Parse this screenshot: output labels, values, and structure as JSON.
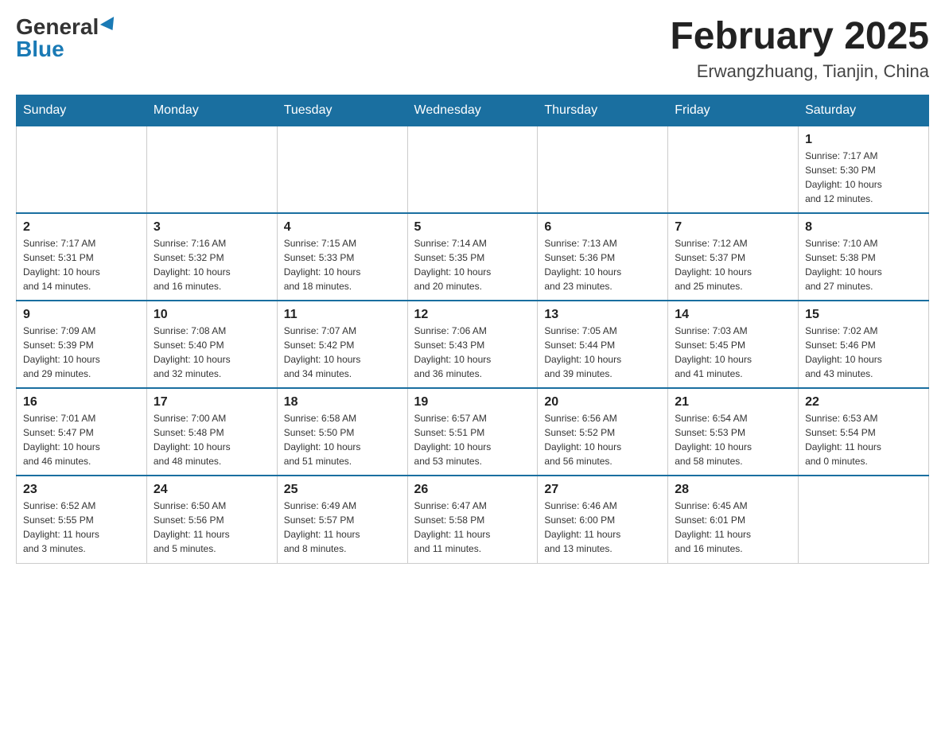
{
  "header": {
    "logo_general": "General",
    "logo_blue": "Blue",
    "month_title": "February 2025",
    "location": "Erwangzhuang, Tianjin, China"
  },
  "weekdays": [
    "Sunday",
    "Monday",
    "Tuesday",
    "Wednesday",
    "Thursday",
    "Friday",
    "Saturday"
  ],
  "weeks": [
    [
      {
        "day": "",
        "info": ""
      },
      {
        "day": "",
        "info": ""
      },
      {
        "day": "",
        "info": ""
      },
      {
        "day": "",
        "info": ""
      },
      {
        "day": "",
        "info": ""
      },
      {
        "day": "",
        "info": ""
      },
      {
        "day": "1",
        "info": "Sunrise: 7:17 AM\nSunset: 5:30 PM\nDaylight: 10 hours\nand 12 minutes."
      }
    ],
    [
      {
        "day": "2",
        "info": "Sunrise: 7:17 AM\nSunset: 5:31 PM\nDaylight: 10 hours\nand 14 minutes."
      },
      {
        "day": "3",
        "info": "Sunrise: 7:16 AM\nSunset: 5:32 PM\nDaylight: 10 hours\nand 16 minutes."
      },
      {
        "day": "4",
        "info": "Sunrise: 7:15 AM\nSunset: 5:33 PM\nDaylight: 10 hours\nand 18 minutes."
      },
      {
        "day": "5",
        "info": "Sunrise: 7:14 AM\nSunset: 5:35 PM\nDaylight: 10 hours\nand 20 minutes."
      },
      {
        "day": "6",
        "info": "Sunrise: 7:13 AM\nSunset: 5:36 PM\nDaylight: 10 hours\nand 23 minutes."
      },
      {
        "day": "7",
        "info": "Sunrise: 7:12 AM\nSunset: 5:37 PM\nDaylight: 10 hours\nand 25 minutes."
      },
      {
        "day": "8",
        "info": "Sunrise: 7:10 AM\nSunset: 5:38 PM\nDaylight: 10 hours\nand 27 minutes."
      }
    ],
    [
      {
        "day": "9",
        "info": "Sunrise: 7:09 AM\nSunset: 5:39 PM\nDaylight: 10 hours\nand 29 minutes."
      },
      {
        "day": "10",
        "info": "Sunrise: 7:08 AM\nSunset: 5:40 PM\nDaylight: 10 hours\nand 32 minutes."
      },
      {
        "day": "11",
        "info": "Sunrise: 7:07 AM\nSunset: 5:42 PM\nDaylight: 10 hours\nand 34 minutes."
      },
      {
        "day": "12",
        "info": "Sunrise: 7:06 AM\nSunset: 5:43 PM\nDaylight: 10 hours\nand 36 minutes."
      },
      {
        "day": "13",
        "info": "Sunrise: 7:05 AM\nSunset: 5:44 PM\nDaylight: 10 hours\nand 39 minutes."
      },
      {
        "day": "14",
        "info": "Sunrise: 7:03 AM\nSunset: 5:45 PM\nDaylight: 10 hours\nand 41 minutes."
      },
      {
        "day": "15",
        "info": "Sunrise: 7:02 AM\nSunset: 5:46 PM\nDaylight: 10 hours\nand 43 minutes."
      }
    ],
    [
      {
        "day": "16",
        "info": "Sunrise: 7:01 AM\nSunset: 5:47 PM\nDaylight: 10 hours\nand 46 minutes."
      },
      {
        "day": "17",
        "info": "Sunrise: 7:00 AM\nSunset: 5:48 PM\nDaylight: 10 hours\nand 48 minutes."
      },
      {
        "day": "18",
        "info": "Sunrise: 6:58 AM\nSunset: 5:50 PM\nDaylight: 10 hours\nand 51 minutes."
      },
      {
        "day": "19",
        "info": "Sunrise: 6:57 AM\nSunset: 5:51 PM\nDaylight: 10 hours\nand 53 minutes."
      },
      {
        "day": "20",
        "info": "Sunrise: 6:56 AM\nSunset: 5:52 PM\nDaylight: 10 hours\nand 56 minutes."
      },
      {
        "day": "21",
        "info": "Sunrise: 6:54 AM\nSunset: 5:53 PM\nDaylight: 10 hours\nand 58 minutes."
      },
      {
        "day": "22",
        "info": "Sunrise: 6:53 AM\nSunset: 5:54 PM\nDaylight: 11 hours\nand 0 minutes."
      }
    ],
    [
      {
        "day": "23",
        "info": "Sunrise: 6:52 AM\nSunset: 5:55 PM\nDaylight: 11 hours\nand 3 minutes."
      },
      {
        "day": "24",
        "info": "Sunrise: 6:50 AM\nSunset: 5:56 PM\nDaylight: 11 hours\nand 5 minutes."
      },
      {
        "day": "25",
        "info": "Sunrise: 6:49 AM\nSunset: 5:57 PM\nDaylight: 11 hours\nand 8 minutes."
      },
      {
        "day": "26",
        "info": "Sunrise: 6:47 AM\nSunset: 5:58 PM\nDaylight: 11 hours\nand 11 minutes."
      },
      {
        "day": "27",
        "info": "Sunrise: 6:46 AM\nSunset: 6:00 PM\nDaylight: 11 hours\nand 13 minutes."
      },
      {
        "day": "28",
        "info": "Sunrise: 6:45 AM\nSunset: 6:01 PM\nDaylight: 11 hours\nand 16 minutes."
      },
      {
        "day": "",
        "info": ""
      }
    ]
  ]
}
